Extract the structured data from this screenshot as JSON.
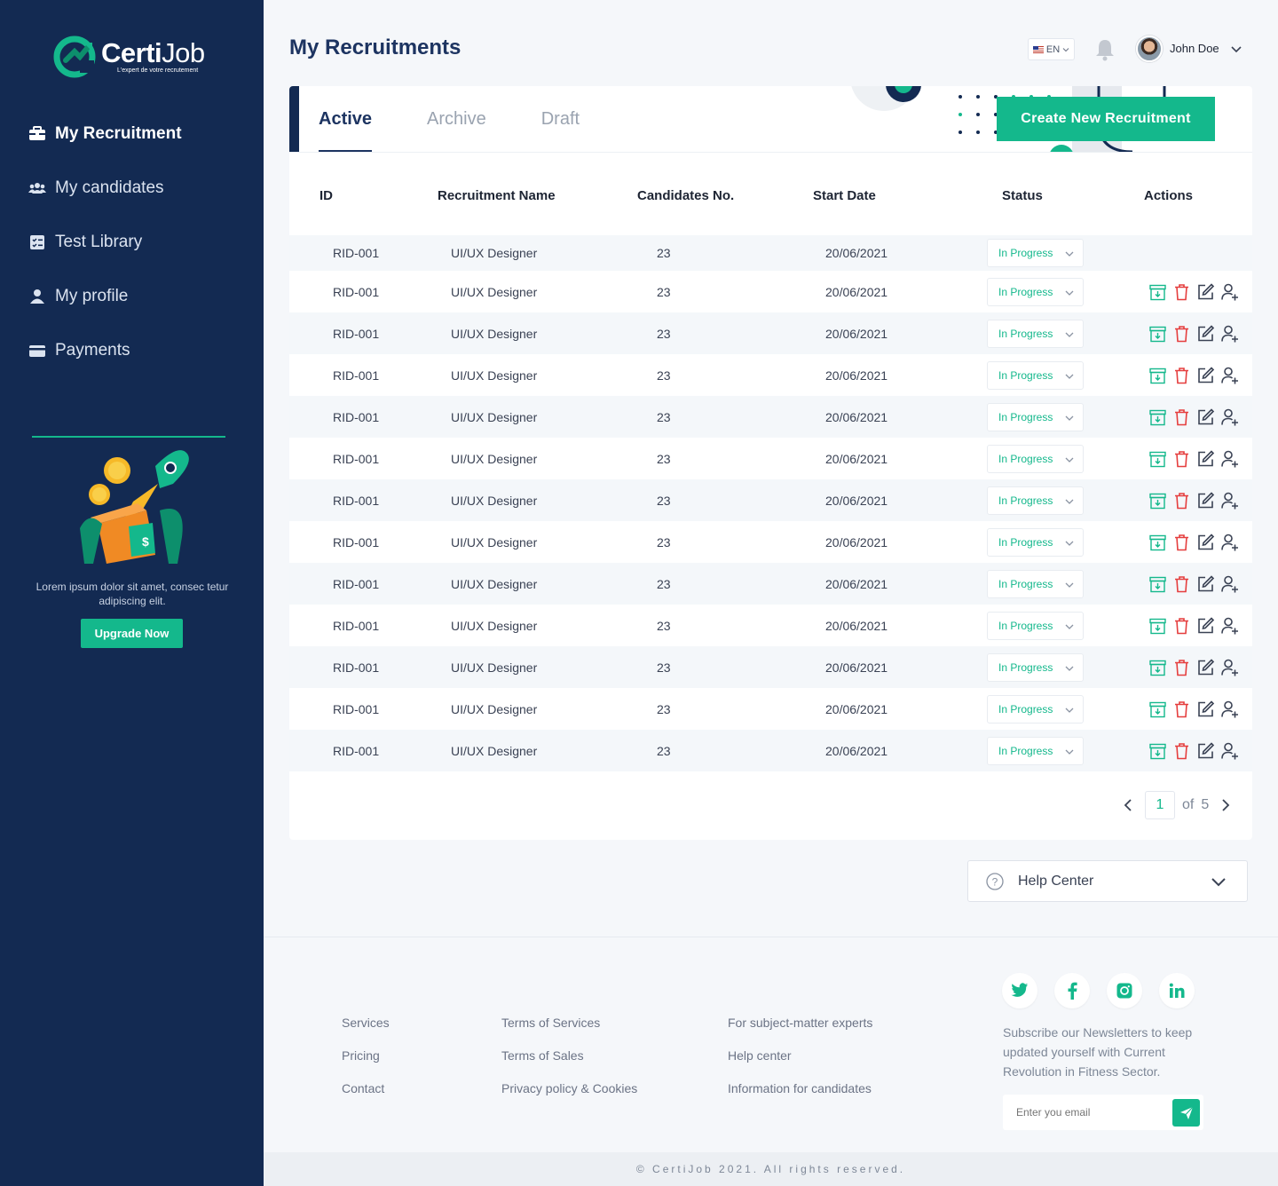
{
  "brand": {
    "name_bold": "Certi",
    "name_light": "Job",
    "tagline": "L'expert de votre recrutement",
    "colors": {
      "navy": "#132a52",
      "accent": "#14b88c",
      "danger": "#e53e3e"
    }
  },
  "sidebar": {
    "items": [
      {
        "label": "My Recruitment",
        "icon": "briefcase-icon",
        "active": true
      },
      {
        "label": "My candidates",
        "icon": "users-icon",
        "active": false
      },
      {
        "label": "Test Library",
        "icon": "checklist-icon",
        "active": false
      },
      {
        "label": "My profile",
        "icon": "user-icon",
        "active": false
      },
      {
        "label": "Payments",
        "icon": "credit-card-icon",
        "active": false
      }
    ],
    "promo": {
      "text": "Lorem ipsum dolor sit amet, consec tetur adipiscing elit.",
      "button": "Upgrade Now"
    }
  },
  "header": {
    "title": "My Recruitments",
    "language": "EN",
    "user_name": "John Doe"
  },
  "tabs": [
    {
      "label": "Active",
      "active": true
    },
    {
      "label": "Archive",
      "active": false
    },
    {
      "label": "Draft",
      "active": false
    }
  ],
  "create_button": "Create New Recruitment",
  "table": {
    "columns": [
      "ID",
      "Recruitment Name",
      "Candidates No.",
      "Start Date",
      "Status",
      "Actions"
    ],
    "rows": [
      {
        "id": "RID-001",
        "name": "UI/UX Designer",
        "candidates": "23",
        "start_date": "20/06/2021",
        "status": "In Progress",
        "show_actions": false
      },
      {
        "id": "RID-001",
        "name": "UI/UX Designer",
        "candidates": "23",
        "start_date": "20/06/2021",
        "status": "In Progress",
        "show_actions": true
      },
      {
        "id": "RID-001",
        "name": "UI/UX Designer",
        "candidates": "23",
        "start_date": "20/06/2021",
        "status": "In Progress",
        "show_actions": true
      },
      {
        "id": "RID-001",
        "name": "UI/UX Designer",
        "candidates": "23",
        "start_date": "20/06/2021",
        "status": "In Progress",
        "show_actions": true
      },
      {
        "id": "RID-001",
        "name": "UI/UX Designer",
        "candidates": "23",
        "start_date": "20/06/2021",
        "status": "In Progress",
        "show_actions": true
      },
      {
        "id": "RID-001",
        "name": "UI/UX Designer",
        "candidates": "23",
        "start_date": "20/06/2021",
        "status": "In Progress",
        "show_actions": true
      },
      {
        "id": "RID-001",
        "name": "UI/UX Designer",
        "candidates": "23",
        "start_date": "20/06/2021",
        "status": "In Progress",
        "show_actions": true
      },
      {
        "id": "RID-001",
        "name": "UI/UX Designer",
        "candidates": "23",
        "start_date": "20/06/2021",
        "status": "In Progress",
        "show_actions": true
      },
      {
        "id": "RID-001",
        "name": "UI/UX Designer",
        "candidates": "23",
        "start_date": "20/06/2021",
        "status": "In Progress",
        "show_actions": true
      },
      {
        "id": "RID-001",
        "name": "UI/UX Designer",
        "candidates": "23",
        "start_date": "20/06/2021",
        "status": "In Progress",
        "show_actions": true
      },
      {
        "id": "RID-001",
        "name": "UI/UX Designer",
        "candidates": "23",
        "start_date": "20/06/2021",
        "status": "In Progress",
        "show_actions": true
      },
      {
        "id": "RID-001",
        "name": "UI/UX Designer",
        "candidates": "23",
        "start_date": "20/06/2021",
        "status": "In Progress",
        "show_actions": true
      },
      {
        "id": "RID-001",
        "name": "UI/UX Designer",
        "candidates": "23",
        "start_date": "20/06/2021",
        "status": "In Progress",
        "show_actions": true
      }
    ]
  },
  "pagination": {
    "current": "1",
    "of_label": "of",
    "total": "5"
  },
  "help_center": {
    "label": "Help Center"
  },
  "footer": {
    "col1": [
      "Services",
      "Pricing",
      "Contact"
    ],
    "col2": [
      "Terms of Services",
      "Terms of Sales",
      "Privacy policy & Cookies"
    ],
    "col3": [
      "For subject-matter experts",
      "Help center",
      "Information for candidates"
    ],
    "social": [
      "twitter-icon",
      "facebook-icon",
      "instagram-icon",
      "linkedin-icon"
    ],
    "newsletter_text": "Subscribe our Newsletters to keep updated yourself with Current Revolution in Fitness Sector.",
    "email_placeholder": "Enter you email",
    "copyright": "© CertiJob 2021. All rights reserved."
  }
}
